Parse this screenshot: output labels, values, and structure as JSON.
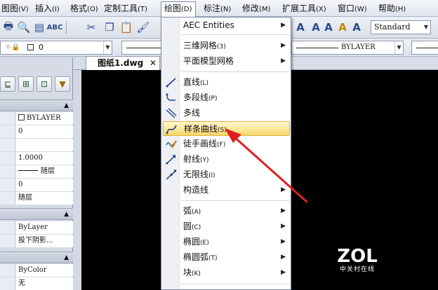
{
  "menubar": {
    "items": [
      {
        "label": "图图",
        "acc": "(V)"
      },
      {
        "label": "插入",
        "acc": "(I)"
      },
      {
        "label": "格式",
        "acc": "(O)"
      },
      {
        "label": "定制工具",
        "acc": "(T)"
      },
      {
        "label": "绘图",
        "acc": "(D)"
      },
      {
        "label": "标注",
        "acc": "(N)"
      },
      {
        "label": "修改",
        "acc": "(M)"
      },
      {
        "label": "扩展工具",
        "acc": "(X)"
      },
      {
        "label": "窗口",
        "acc": "(W)"
      },
      {
        "label": "帮助",
        "acc": "(H)"
      }
    ]
  },
  "toolbar": {
    "text_style": "Standard"
  },
  "layer_bar": {
    "layer_name": "0",
    "linetype_label": "BYLAYER"
  },
  "document": {
    "tab_title": "图纸1.dwg",
    "tab_close": "✕"
  },
  "properties": {
    "general": [
      {
        "value": "BYLAYER",
        "checkbox": true
      },
      {
        "value": "0"
      },
      {
        "value": ""
      },
      {
        "value": "1.0000"
      },
      {
        "value": "随层",
        "dash": true
      },
      {
        "value": "0"
      },
      {
        "value": "随层"
      }
    ],
    "view": [
      {
        "value": "ByLayer"
      },
      {
        "value": "投下阴影..."
      }
    ],
    "misc": [
      {
        "value": "ByColor"
      },
      {
        "value": "无"
      }
    ]
  },
  "draw_menu": {
    "items": [
      {
        "label": "AEC Entities",
        "acc": "",
        "submenu": true,
        "icon": ""
      },
      {
        "label": "三维网格",
        "acc": "(3)",
        "submenu": true,
        "icon": ""
      },
      {
        "label": "平面模型网格",
        "acc": "",
        "submenu": true,
        "icon": ""
      },
      {
        "label": "直线",
        "acc": "(L)",
        "submenu": false,
        "icon": "line-icon"
      },
      {
        "label": "多段线",
        "acc": "(P)",
        "submenu": false,
        "icon": "polyline-icon"
      },
      {
        "label": "多线",
        "acc": "",
        "submenu": false,
        "icon": "multiline-icon"
      },
      {
        "label": "样条曲线",
        "acc": "(S)",
        "submenu": false,
        "icon": "spline-icon",
        "highlight": true
      },
      {
        "label": "徒手画线",
        "acc": "(F)",
        "submenu": false,
        "icon": "freehand-icon"
      },
      {
        "label": "射线",
        "acc": "(Y)",
        "submenu": false,
        "icon": "ray-icon"
      },
      {
        "label": "无限线",
        "acc": "(I)",
        "submenu": false,
        "icon": "xline-icon"
      },
      {
        "label": "构造线",
        "acc": "",
        "submenu": true,
        "icon": ""
      },
      {
        "label": "弧",
        "acc": "(A)",
        "submenu": true,
        "icon": ""
      },
      {
        "label": "圆",
        "acc": "(C)",
        "submenu": true,
        "icon": ""
      },
      {
        "label": "椭圆",
        "acc": "(E)",
        "submenu": true,
        "icon": ""
      },
      {
        "label": "椭圆弧",
        "acc": "(T)",
        "submenu": true,
        "icon": ""
      },
      {
        "label": "块",
        "acc": "(K)",
        "submenu": true,
        "icon": ""
      }
    ]
  },
  "watermark": {
    "logo": "ZOL",
    "sub": "中关村在线"
  },
  "colors": {
    "highlight": "#fde79b",
    "annotation_arrow": "#e01f1f",
    "canvas": "#000000"
  }
}
